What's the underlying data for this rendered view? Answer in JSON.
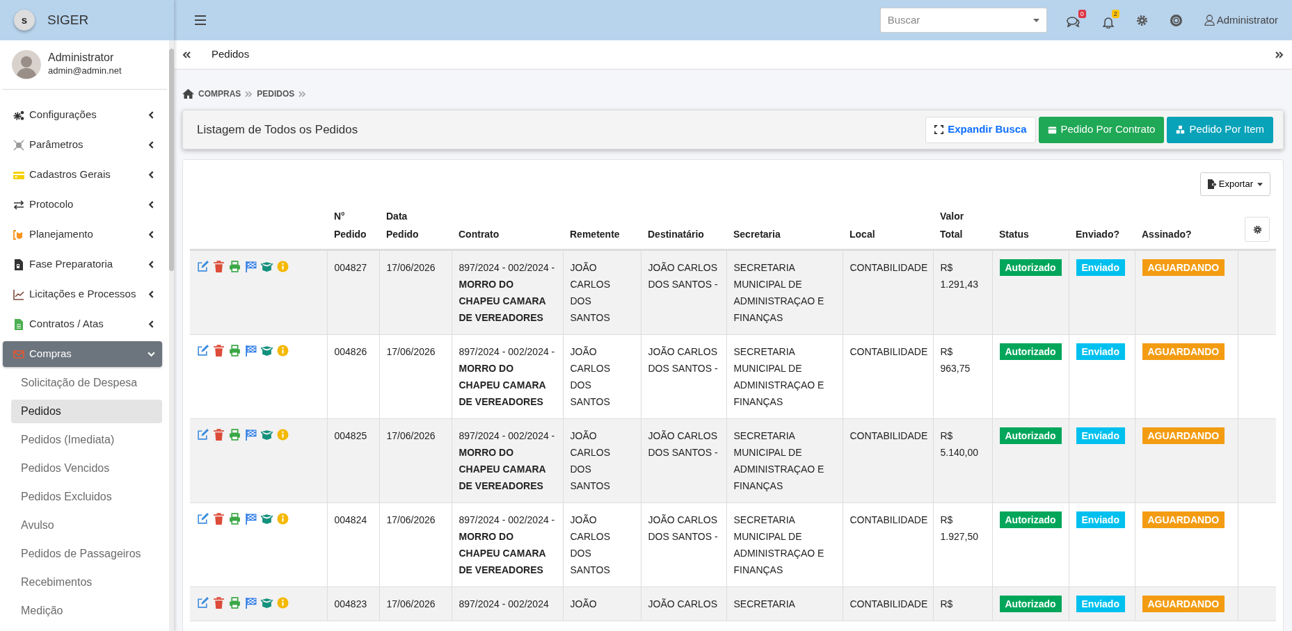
{
  "brand": {
    "logo_letter": "s",
    "name": "SIGER"
  },
  "topbar": {
    "search": {
      "placeholder": "Buscar"
    },
    "messages_count": "0",
    "notifications_count": "2",
    "user": "Administrator"
  },
  "user": {
    "name": "Administrator",
    "email": "admin@admin.net"
  },
  "sidebar": {
    "items": [
      {
        "label": "Configurações",
        "expanded": false,
        "selected": false
      },
      {
        "label": "Parâmetros",
        "expanded": false,
        "selected": false
      },
      {
        "label": "Cadastros Gerais",
        "expanded": false,
        "selected": false
      },
      {
        "label": "Protocolo",
        "expanded": false,
        "selected": false
      },
      {
        "label": "Planejamento",
        "expanded": false,
        "selected": false
      },
      {
        "label": "Fase Preparatoria",
        "expanded": false,
        "selected": false
      },
      {
        "label": "Licitações e Processos",
        "expanded": false,
        "selected": false
      },
      {
        "label": "Contratos / Atas",
        "expanded": false,
        "selected": false
      },
      {
        "label": "Compras",
        "expanded": true,
        "selected": true,
        "children": [
          {
            "label": "Solicitação de Despesa",
            "selected": false
          },
          {
            "label": "Pedidos",
            "selected": true
          },
          {
            "label": "Pedidos (Imediata)",
            "selected": false
          },
          {
            "label": "Pedidos Vencidos",
            "selected": false
          },
          {
            "label": "Pedidos Excluidos",
            "selected": false
          },
          {
            "label": "Avulso",
            "selected": false
          },
          {
            "label": "Pedidos de Passageiros",
            "selected": false
          },
          {
            "label": "Recebimentos",
            "selected": false
          },
          {
            "label": "Medição",
            "selected": false
          }
        ]
      }
    ]
  },
  "page_tab": "Pedidos",
  "breadcrumb": [
    "COMPRAS",
    "PEDIDOS"
  ],
  "panel": {
    "title": "Listagem de Todos os Pedidos",
    "buttons": [
      {
        "label": "Expandir Busca",
        "kind": "outline"
      },
      {
        "label": "Pedido Por Contrato",
        "kind": "success"
      },
      {
        "label": "Pedido Por Item",
        "kind": "info"
      }
    ]
  },
  "export_button": "Exportar",
  "table": {
    "columns": [
      "N° Pedido",
      "Data Pedido",
      "Contrato",
      "Remetente",
      "Destinatário",
      "Secretaria",
      "Local",
      "Valor Total",
      "Status",
      "Enviado?",
      "Assinado?"
    ],
    "rows": [
      {
        "numero": "004827",
        "data": "17/06/2026",
        "contrato": "897/2024 - 002/2024 - **MORRO DO CHAPEU CAMARA DE VEREADORES**",
        "remetente": "JOÃO CARLOS DOS SANTOS",
        "destinatario": "JOÃO CARLOS DOS SANTOS -",
        "secretaria": "SECRETARIA MUNICIPAL DE ADMINISTRAÇAO E FINANÇAS",
        "local": "CONTABILIDADE",
        "valor": "R$ 1.291,43",
        "status": "Autorizado",
        "enviado": "Enviado",
        "assinado": "AGUARDANDO"
      },
      {
        "numero": "004826",
        "data": "17/06/2026",
        "contrato": "897/2024 - 002/2024 - **MORRO DO CHAPEU CAMARA DE VEREADORES**",
        "remetente": "JOÃO CARLOS DOS SANTOS",
        "destinatario": "JOÃO CARLOS DOS SANTOS -",
        "secretaria": "SECRETARIA MUNICIPAL DE ADMINISTRAÇAO E FINANÇAS",
        "local": "CONTABILIDADE",
        "valor": "R$ 963,75",
        "status": "Autorizado",
        "enviado": "Enviado",
        "assinado": "AGUARDANDO"
      },
      {
        "numero": "004825",
        "data": "17/06/2026",
        "contrato": "897/2024 - 002/2024 - **MORRO DO CHAPEU CAMARA DE VEREADORES**",
        "remetente": "JOÃO CARLOS DOS SANTOS",
        "destinatario": "JOÃO CARLOS DOS SANTOS -",
        "secretaria": "SECRETARIA MUNICIPAL DE ADMINISTRAÇAO E FINANÇAS",
        "local": "CONTABILIDADE",
        "valor": "R$ 5.140,00",
        "status": "Autorizado",
        "enviado": "Enviado",
        "assinado": "AGUARDANDO"
      },
      {
        "numero": "004824",
        "data": "17/06/2026",
        "contrato": "897/2024 - 002/2024 - **MORRO DO CHAPEU CAMARA DE VEREADORES**",
        "remetente": "JOÃO CARLOS DOS SANTOS",
        "destinatario": "JOÃO CARLOS DOS SANTOS -",
        "secretaria": "SECRETARIA MUNICIPAL DE ADMINISTRAÇAO E FINANÇAS",
        "local": "CONTABILIDADE",
        "valor": "R$ 1.927,50",
        "status": "Autorizado",
        "enviado": "Enviado",
        "assinado": "AGUARDANDO"
      },
      {
        "numero": "004823",
        "data": "17/06/2026",
        "contrato": "897/2024 - 002/2024",
        "remetente": "JOÃO",
        "destinatario": "JOÃO CARLOS",
        "secretaria": "SECRETARIA",
        "local": "CONTABILIDADE",
        "valor": "R$",
        "status": "Autorizado",
        "enviado": "Enviado",
        "assinado": "AGUARDANDO"
      }
    ]
  }
}
